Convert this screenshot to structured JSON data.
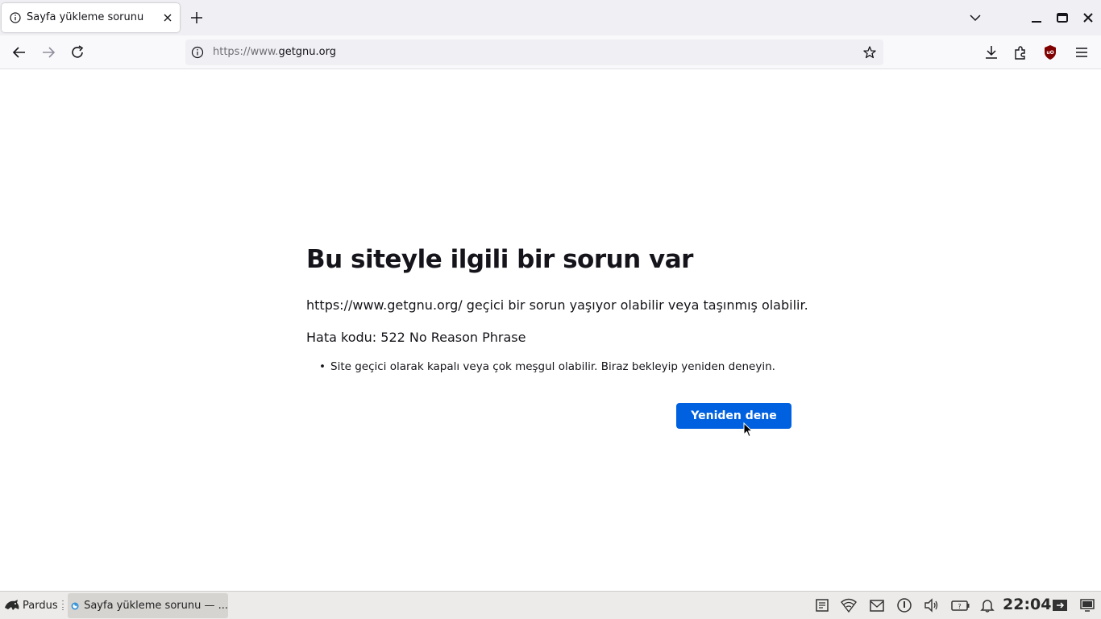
{
  "browser": {
    "tab": {
      "title": "Sayfa yükleme sorunu"
    },
    "url": {
      "prefix": "https://www.",
      "host": "getgnu.org"
    }
  },
  "error_page": {
    "title": "Bu siteyle ilgili bir sorun var",
    "description": "https://www.getgnu.org/ geçici bir sorun yaşıyor olabilir veya taşınmış olabilir.",
    "error_code": "Hata kodu: 522 No Reason Phrase",
    "suggestions": [
      "Site geçici olarak kapalı veya çok meşgul olabilir. Biraz bekleyip yeniden deneyin."
    ],
    "retry_label": "Yeniden dene"
  },
  "taskbar": {
    "start_label": "Pardus",
    "window_label": "Sayfa yükleme sorunu — ...",
    "clock": "22:04"
  },
  "colors": {
    "accent": "#0061e0",
    "tab_strip": "#f0f0f4",
    "taskbar": "#ecebe9"
  },
  "icons": {
    "tab": [
      "info-icon",
      "close-icon",
      "plus-icon",
      "chevron-down-icon",
      "minimize-icon",
      "maximize-icon",
      "window-close-icon"
    ],
    "nav": [
      "back-arrow-icon",
      "forward-arrow-icon",
      "reload-icon",
      "info-icon",
      "star-icon",
      "download-icon",
      "extensions-icon",
      "ublock-icon",
      "menu-icon"
    ],
    "tray": [
      "notes-icon",
      "wifi-icon",
      "mail-icon",
      "clipboard-icon",
      "volume-icon",
      "battery-icon",
      "bell-icon",
      "logout-icon",
      "desktop-icon"
    ]
  }
}
